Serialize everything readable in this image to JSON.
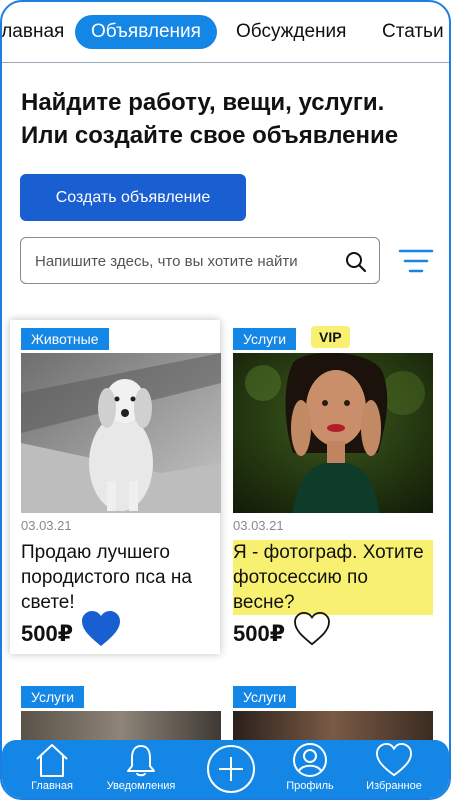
{
  "tabs": [
    {
      "label": "Главная"
    },
    {
      "label": "Объявления",
      "active": true
    },
    {
      "label": "Обсуждения"
    },
    {
      "label": "Статьи"
    }
  ],
  "headline": {
    "line1": "Найдите работу, вещи, услуги.",
    "line2": "Или создайте свое объявление"
  },
  "create_button": {
    "label": "Создать объявление"
  },
  "search": {
    "placeholder": "Напишите здесь, что вы хотите найти"
  },
  "colors": {
    "accent": "#1386e6",
    "button": "#1a5fd1",
    "highlight": "#f8f070"
  },
  "listings": [
    {
      "tag": "Животные",
      "date": "03.03.21",
      "title": "Продаю лучшего породистого пса на свете!",
      "price": "500₽",
      "favorite": true
    },
    {
      "tag": "Услуги",
      "vip": "VIP",
      "date": "03.03.21",
      "title": "Я - фотограф. Хотите фотосессию по весне?",
      "price": "500₽",
      "favorite": false
    },
    {
      "tag": "Услуги"
    },
    {
      "tag": "Услуги"
    }
  ],
  "bottom_nav": [
    {
      "label": "Главная",
      "icon": "home-icon"
    },
    {
      "label": "Уведомления",
      "icon": "bell-icon"
    },
    {
      "label": "",
      "icon": "plus-icon"
    },
    {
      "label": "Профиль",
      "icon": "profile-icon"
    },
    {
      "label": "Избранное",
      "icon": "heart-icon"
    }
  ]
}
